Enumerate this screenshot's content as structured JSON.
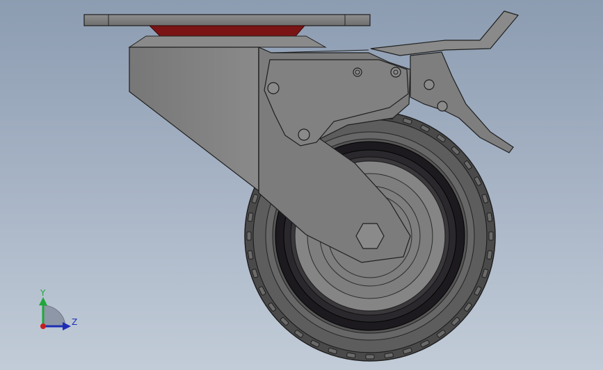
{
  "viewport": {
    "colors": {
      "background_top": "#8c9cb1",
      "background_bottom": "#c2ccd8",
      "part_face": "#7d7d7d",
      "part_dark": "#5e5e5e",
      "edge": "#1e1e1e",
      "accent_red": "#7a1414"
    }
  },
  "triad": {
    "y_label": "Y",
    "z_label": "Z",
    "colors": {
      "x": "#c81e1e",
      "y": "#1fa83a",
      "z": "#1e2db4"
    }
  }
}
